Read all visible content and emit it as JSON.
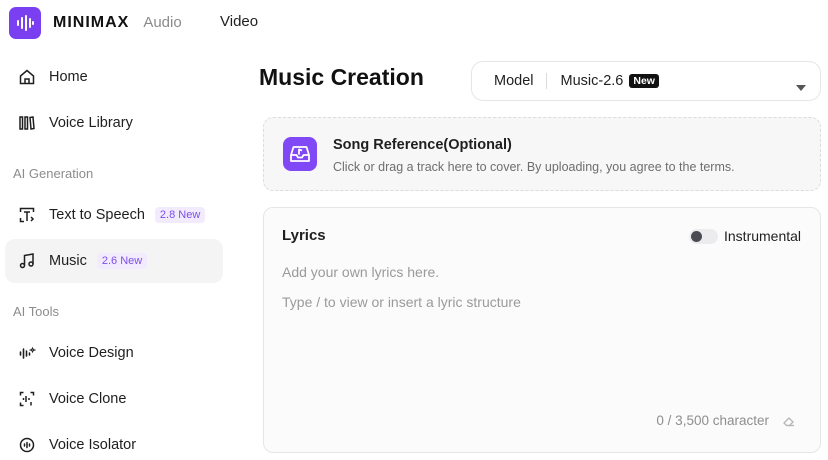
{
  "header": {
    "brand": "MINIMAX",
    "brand_sub": "Audio",
    "nav_video": "Video"
  },
  "sidebar": {
    "items_top": [
      {
        "label": "Home",
        "icon": "home-icon"
      },
      {
        "label": "Voice Library",
        "icon": "library-icon"
      }
    ],
    "section_ai_generation": "AI Generation",
    "items_generation": [
      {
        "label": "Text to Speech",
        "badge": "2.8 New",
        "icon": "text-to-speech-icon"
      },
      {
        "label": "Music",
        "badge": "2.6 New",
        "icon": "music-note-icon",
        "active": true
      }
    ],
    "section_ai_tools": "AI Tools",
    "items_tools": [
      {
        "label": "Voice Design",
        "icon": "voice-design-icon"
      },
      {
        "label": "Voice Clone",
        "icon": "voice-clone-icon"
      },
      {
        "label": "Voice Isolator",
        "icon": "voice-isolator-icon"
      }
    ]
  },
  "main": {
    "title": "Music Creation",
    "model": {
      "label": "Model",
      "value": "Music-2.6",
      "tag": "New"
    },
    "song_reference": {
      "title": "Song Reference(Optional)",
      "description": "Click or drag a track here to cover. By uploading, you agree to the terms."
    },
    "lyrics": {
      "title": "Lyrics",
      "instrumental_label": "Instrumental",
      "instrumental_on": false,
      "placeholder": "Add your own lyrics here.",
      "hint": "Type / to view or insert a lyric structure",
      "char_count": "0 / 3,500 character"
    }
  },
  "colors": {
    "brand_purple": "#7b3ff2",
    "badge_text": "#7d4fe6",
    "badge_bg": "#f1ebfd"
  }
}
